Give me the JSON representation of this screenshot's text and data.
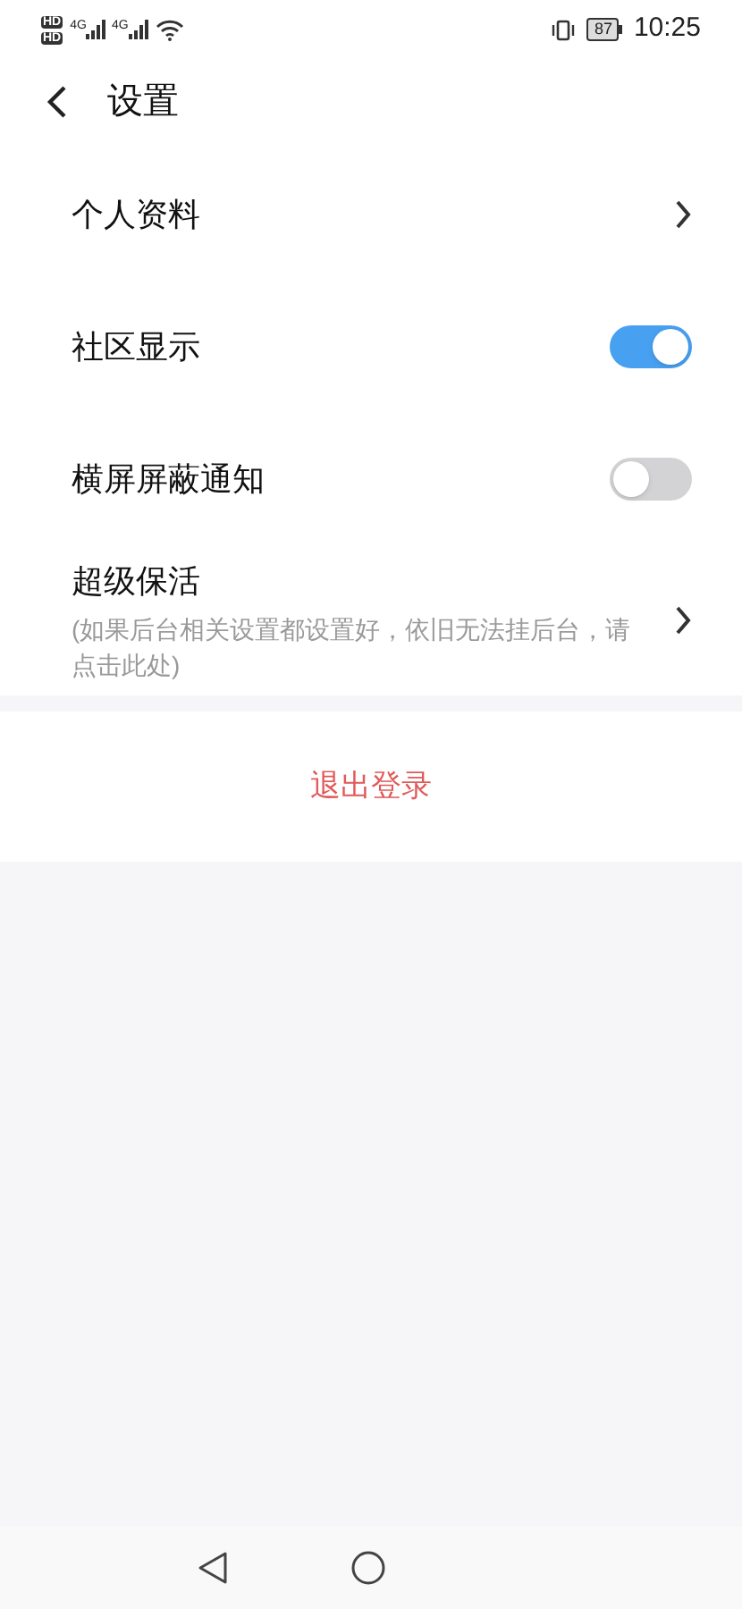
{
  "status_bar": {
    "sim_labels": [
      "HD",
      "HD"
    ],
    "network_labels": [
      "4G",
      "4G"
    ],
    "battery": "87",
    "time": "10:25"
  },
  "header": {
    "title": "设置"
  },
  "settings": [
    {
      "kind": "link",
      "label": "个人资料"
    },
    {
      "kind": "toggle",
      "label": "社区显示",
      "on": true
    },
    {
      "kind": "toggle",
      "label": "横屏屏蔽通知",
      "on": false
    },
    {
      "kind": "link",
      "label": "超级保活",
      "description": "(如果后台相关设置都设置好，依旧无法挂后台，请点击此处)"
    }
  ],
  "logout_button": "退出登录"
}
